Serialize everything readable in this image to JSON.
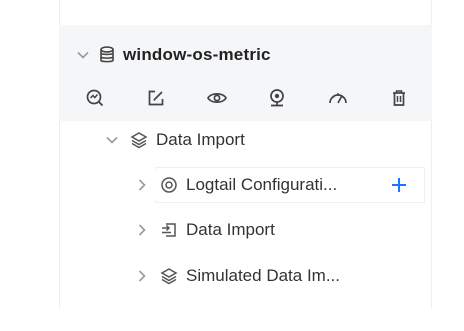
{
  "project": {
    "title": "window-os-metric",
    "icon": "database-icon"
  },
  "toolbar": [
    {
      "name": "chart-search-icon"
    },
    {
      "name": "edit-icon"
    },
    {
      "name": "eye-icon"
    },
    {
      "name": "webcam-icon"
    },
    {
      "name": "gauge-icon"
    },
    {
      "name": "trash-icon"
    }
  ],
  "tree": {
    "data_import": {
      "label": "Data Import",
      "icon": "layers-icon",
      "expanded": true
    },
    "children": [
      {
        "label": "Logtail Configurati...",
        "icon": "target-icon",
        "action": "+"
      },
      {
        "label": "Data Import",
        "icon": "import-icon"
      },
      {
        "label": "Simulated Data Im...",
        "icon": "layers-icon"
      }
    ]
  },
  "colors": {
    "accent": "#1677ff",
    "header_bg": "#f5f6f8",
    "icon": "#555555",
    "chevron": "#9a9a9a"
  }
}
